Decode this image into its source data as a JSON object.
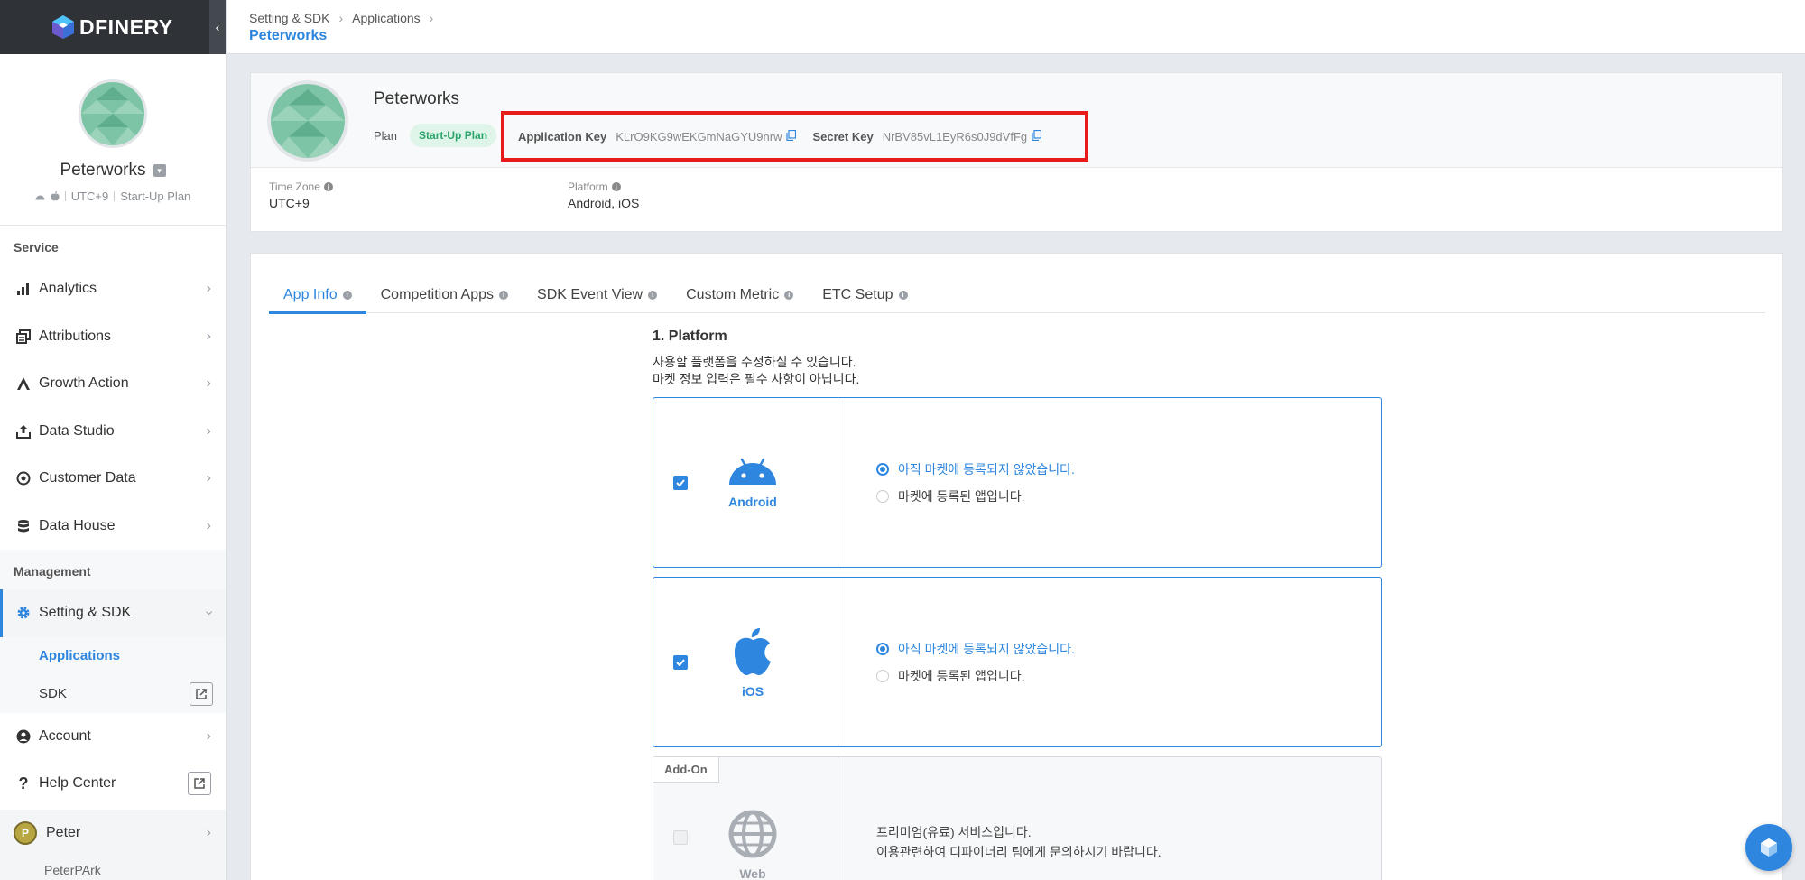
{
  "brand": {
    "name": "DFINERY"
  },
  "profile": {
    "name": "Peterworks",
    "timezone": "UTC+9",
    "plan": "Start-Up Plan"
  },
  "sidebar": {
    "service_title": "Service",
    "service_items": [
      {
        "label": "Analytics",
        "icon": "bar-chart-icon"
      },
      {
        "label": "Attributions",
        "icon": "layers-icon"
      },
      {
        "label": "Growth Action",
        "icon": "growth-icon"
      },
      {
        "label": "Data Studio",
        "icon": "upload-icon"
      },
      {
        "label": "Customer Data",
        "icon": "target-icon"
      },
      {
        "label": "Data House",
        "icon": "database-icon"
      }
    ],
    "management_title": "Management",
    "setting_label": "Setting & SDK",
    "sub_items": [
      {
        "label": "Applications"
      },
      {
        "label": "SDK"
      }
    ],
    "account_label": "Account",
    "help_label": "Help Center",
    "user": {
      "initial": "P",
      "name": "Peter",
      "sub": "PeterPArk"
    }
  },
  "header": {
    "breadcrumb": [
      "Setting & SDK",
      "Applications"
    ],
    "title": "Peterworks"
  },
  "app": {
    "name": "Peterworks",
    "plan_label": "Plan",
    "plan_badge": "Start-Up Plan",
    "app_key_label": "Application Key",
    "app_key": "KLrO9KG9wEKGmNaGYU9nrw",
    "secret_key_label": "Secret Key",
    "secret_key": "NrBV85vL1EyR6s0J9dVfFg",
    "timezone_label": "Time Zone",
    "timezone": "UTC+9",
    "platform_label": "Platform",
    "platform": "Android, iOS"
  },
  "tabs": [
    {
      "label": "App Info"
    },
    {
      "label": "Competition Apps"
    },
    {
      "label": "SDK Event View"
    },
    {
      "label": "Custom Metric"
    },
    {
      "label": "ETC Setup"
    }
  ],
  "platform_section": {
    "title": "1. Platform",
    "desc1": "사용할 플랫폼을 수정하실 수 있습니다.",
    "desc2": "마켓 정보 입력은 필수 사항이 아닙니다.",
    "android": {
      "name": "Android",
      "opt1": "아직 마켓에 등록되지 않았습니다.",
      "opt2": "마켓에 등록된 앱입니다."
    },
    "ios": {
      "name": "iOS",
      "opt1": "아직 마켓에 등록되지 않았습니다.",
      "opt2": "마켓에 등록된 앱입니다."
    },
    "web": {
      "badge": "Add-On",
      "name": "Web",
      "line1": "프리미엄(유료) 서비스입니다.",
      "line2": "이용관련하여 디파이너리 팀에게 문의하시기 바랍니다."
    }
  },
  "colors": {
    "accent": "#2e86de",
    "highlight": "#e81b1b",
    "plan_green": "#2ba36a"
  }
}
